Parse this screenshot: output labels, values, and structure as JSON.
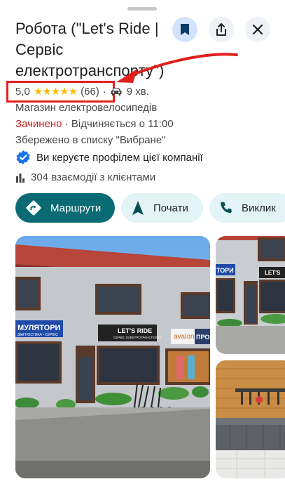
{
  "place": {
    "title": "Робота (\"Let's Ride | Сервіс електротранспорту\")",
    "rating": "5,0",
    "stars": "★★★★★",
    "reviews": "(66)",
    "separator": "·",
    "drive_time": "9 хв.",
    "category": "Магазин електровелосипедів",
    "status": "Зачинено",
    "status_detail": " · Відчиняється о 11:00",
    "saved": "Збережено в списку \"Вибране\"",
    "verified": "Ви керуєте профілем цієї компанії",
    "interactions": "304 взаємодії з клієнтами"
  },
  "actions": {
    "routes": "Маршрути",
    "start": "Почати",
    "call": "Виклик"
  },
  "photos": {
    "main_sign_left": "МУЛЯТОРИ",
    "main_sign_left_sub": "ДІАГНОСТИКА • СЕРВІС",
    "main_sign_center": "LET'S RIDE",
    "main_sign_center_sub": "СЕРВІС ЕЛЕКТРОТРАНСПОРТУ",
    "main_sign_right": "avalon",
    "main_sign_right2": "ПРО",
    "side_sign_left": "ТОРИ",
    "side_sign_right": "LET'S"
  },
  "colors": {
    "accent": "#0b6b74",
    "highlight": "#e0201b",
    "closed": "#c5221f",
    "star": "#fbbc04"
  }
}
